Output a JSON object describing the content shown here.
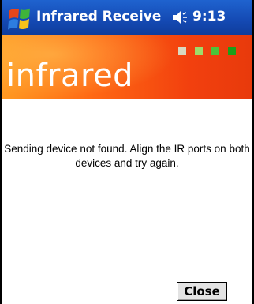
{
  "titlebar": {
    "app_title": "Infrared Receive",
    "time": "9:13",
    "start_icon": "windows-flag-icon",
    "volume_icon": "speaker-icon"
  },
  "banner": {
    "word": "infrared",
    "indicator_colors": [
      "#d9d9c0",
      "#9ddc6a",
      "#4cc43a",
      "#1aa01a"
    ]
  },
  "dialog": {
    "message": "Sending device not found. Align the IR ports on both devices and try again.",
    "close_label": "Close"
  },
  "colors": {
    "titlebar": "#1449b3",
    "banner": "#ff6a14"
  }
}
